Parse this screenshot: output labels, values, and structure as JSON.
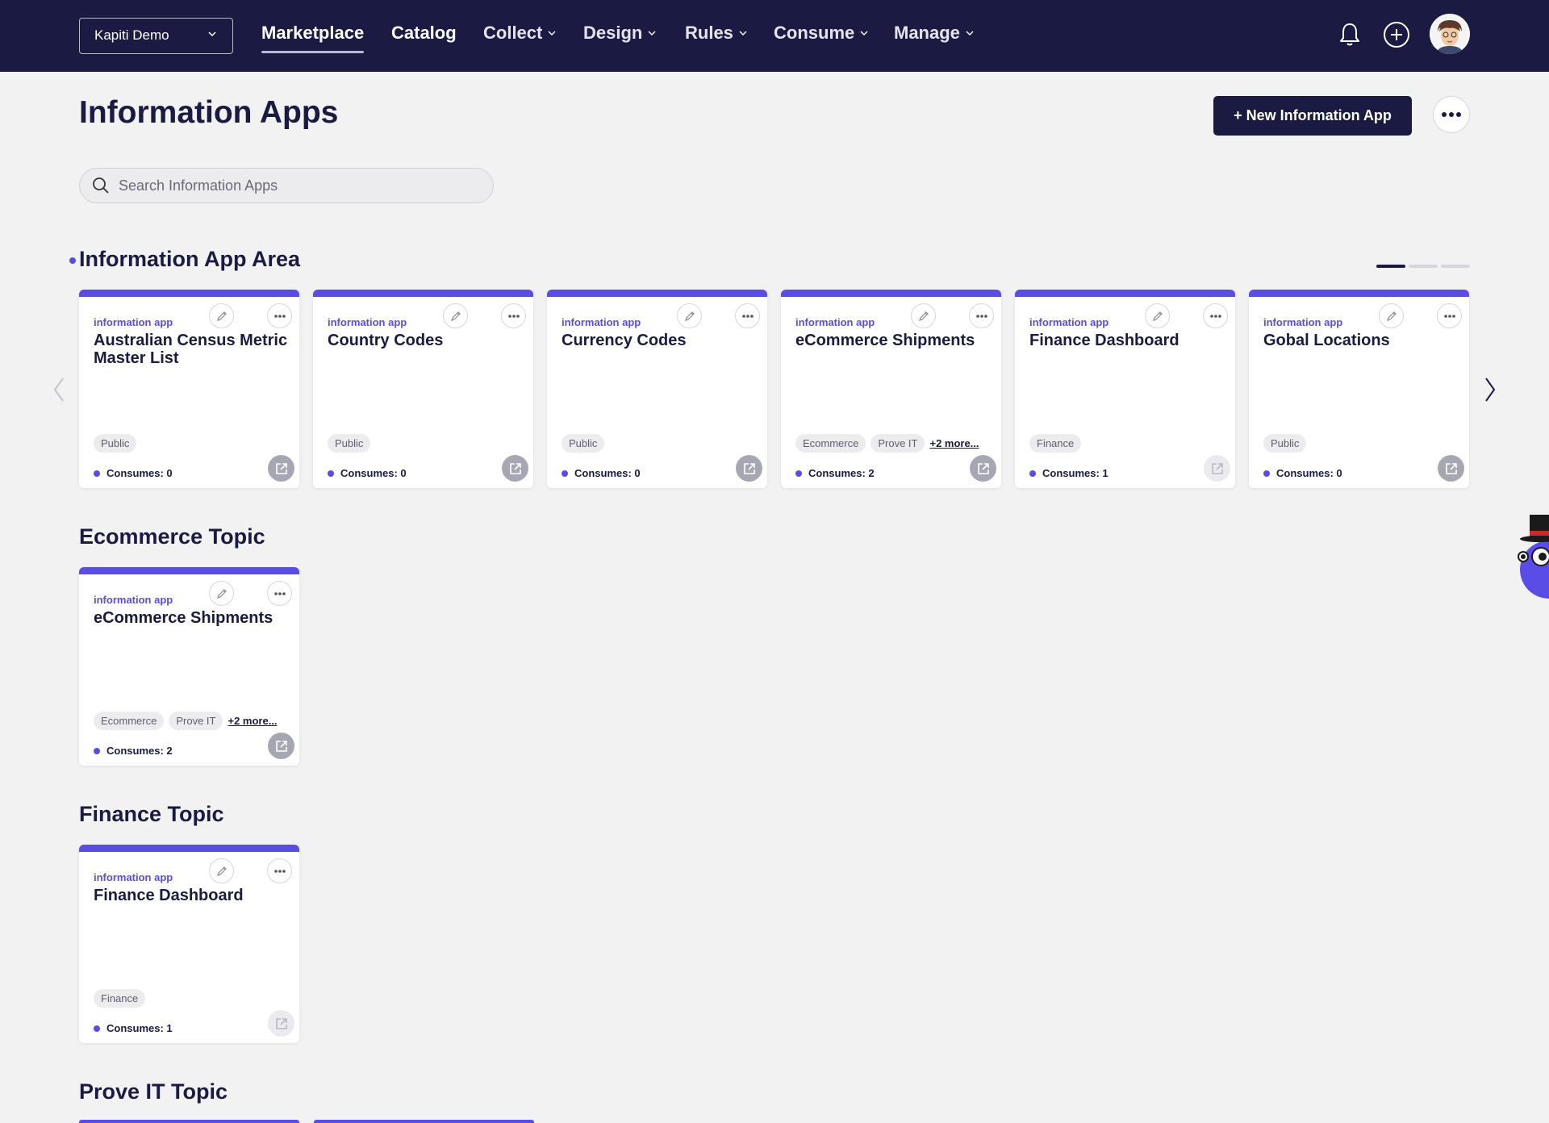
{
  "nav": {
    "workspace": "Kapiti Demo",
    "links": [
      {
        "label": "Marketplace",
        "dropdown": false
      },
      {
        "label": "Catalog",
        "dropdown": false
      },
      {
        "label": "Collect",
        "dropdown": true
      },
      {
        "label": "Design",
        "dropdown": true
      },
      {
        "label": "Rules",
        "dropdown": true
      },
      {
        "label": "Consume",
        "dropdown": true
      },
      {
        "label": "Manage",
        "dropdown": true
      }
    ],
    "icons": [
      "bell-icon",
      "plus-circle-icon",
      "user-avatar"
    ]
  },
  "header": {
    "title": "Information Apps",
    "new_button": "+ New Information App",
    "search_placeholder": "Search Information Apps"
  },
  "sections": [
    {
      "title": "Information App Area",
      "carousel": true,
      "cards": [
        {
          "type": "information app",
          "name": "Australian Census Metric Master List",
          "tags": [
            "Public"
          ],
          "more": "",
          "consumes": "Consumes: 0"
        },
        {
          "type": "information app",
          "name": "Country Codes",
          "tags": [
            "Public"
          ],
          "more": "",
          "consumes": "Consumes: 0"
        },
        {
          "type": "information app",
          "name": "Currency Codes",
          "tags": [
            "Public"
          ],
          "more": "",
          "consumes": "Consumes: 0"
        },
        {
          "type": "information app",
          "name": "eCommerce Shipments",
          "tags": [
            "Ecommerce",
            "Prove IT"
          ],
          "more": "+2 more...",
          "consumes": "Consumes: 2"
        },
        {
          "type": "information app",
          "name": "Finance Dashboard",
          "tags": [
            "Finance"
          ],
          "more": "",
          "consumes": "Consumes: 1"
        },
        {
          "type": "information app",
          "name": "Gobal Locations",
          "tags": [
            "Public"
          ],
          "more": "",
          "consumes": "Consumes: 0"
        }
      ]
    },
    {
      "title": "Ecommerce Topic",
      "cards": [
        {
          "type": "information app",
          "name": "eCommerce Shipments",
          "tags": [
            "Ecommerce",
            "Prove IT"
          ],
          "more": "+2 more...",
          "consumes": "Consumes: 2"
        }
      ]
    },
    {
      "title": "Finance Topic",
      "cards": [
        {
          "type": "information app",
          "name": "Finance Dashboard",
          "tags": [
            "Finance"
          ],
          "more": "",
          "consumes": "Consumes: 1"
        }
      ]
    },
    {
      "title": "Prove IT Topic",
      "cards": []
    }
  ],
  "colors": {
    "nav_bg": "#1b1a42",
    "accent": "#5a4ce6",
    "page_bg": "#f2f2f3"
  }
}
